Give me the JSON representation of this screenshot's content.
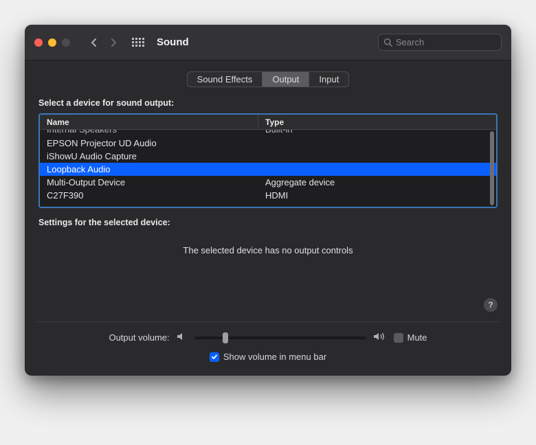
{
  "window": {
    "title": "Sound"
  },
  "search": {
    "placeholder": "Search"
  },
  "tabs": {
    "effects": "Sound Effects",
    "output": "Output",
    "input": "Input"
  },
  "output": {
    "select_label": "Select a device for sound output:",
    "col_name": "Name",
    "col_type": "Type",
    "devices": [
      {
        "name": "Internal Speakers",
        "type": "Built-in",
        "truncated": true
      },
      {
        "name": "EPSON Projector UD Audio",
        "type": ""
      },
      {
        "name": "iShowU Audio Capture",
        "type": ""
      },
      {
        "name": "Loopback Audio",
        "type": "",
        "selected": true
      },
      {
        "name": "Multi-Output Device",
        "type": "Aggregate device"
      },
      {
        "name": "C27F390",
        "type": "HDMI"
      }
    ],
    "settings_label": "Settings for the selected device:",
    "no_controls": "The selected device has no output controls"
  },
  "volume": {
    "label": "Output volume:",
    "mute": "Mute",
    "show_in_menu": "Show volume in menu bar"
  }
}
